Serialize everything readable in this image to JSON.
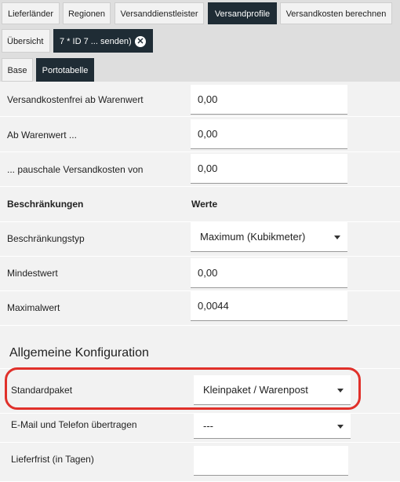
{
  "top_tabs": [
    "Lieferländer",
    "Regionen",
    "Versanddienstleister",
    "Versandprofile",
    "Versandkosten berechnen"
  ],
  "sub_tabs": {
    "overview": "Übersicht",
    "profile": "7 * ID 7 ... senden)"
  },
  "inner_tabs": [
    "Base",
    "Portotabelle"
  ],
  "fields": {
    "free_from_label": "Versandkostenfrei ab Warenwert",
    "free_from_value": "0,00",
    "from_value_label": "Ab Warenwert ...",
    "from_value_value": "0,00",
    "flat_rate_label": "... pauschale Versandkosten von",
    "flat_rate_value": "0,00",
    "restrictions_header": "Beschränkungen",
    "values_header": "Werte",
    "restriction_type_label": "Beschränkungstyp",
    "restriction_type_value": "Maximum (Kubikmeter)",
    "min_label": "Mindestwert",
    "min_value": "0,00",
    "max_label": "Maximalwert",
    "max_value": "0,0044"
  },
  "general": {
    "title": "Allgemeine Konfiguration",
    "default_package_label": "Standardpaket",
    "default_package_value": "Kleinpaket / Warenpost",
    "email_phone_label": "E-Mail und Telefon übertragen",
    "email_phone_value": "---",
    "delivery_time_label": "Lieferfrist (in Tagen)",
    "delivery_time_value": ""
  },
  "colors": {
    "active_tab": "#1f2c35",
    "highlight": "#e0302a"
  }
}
